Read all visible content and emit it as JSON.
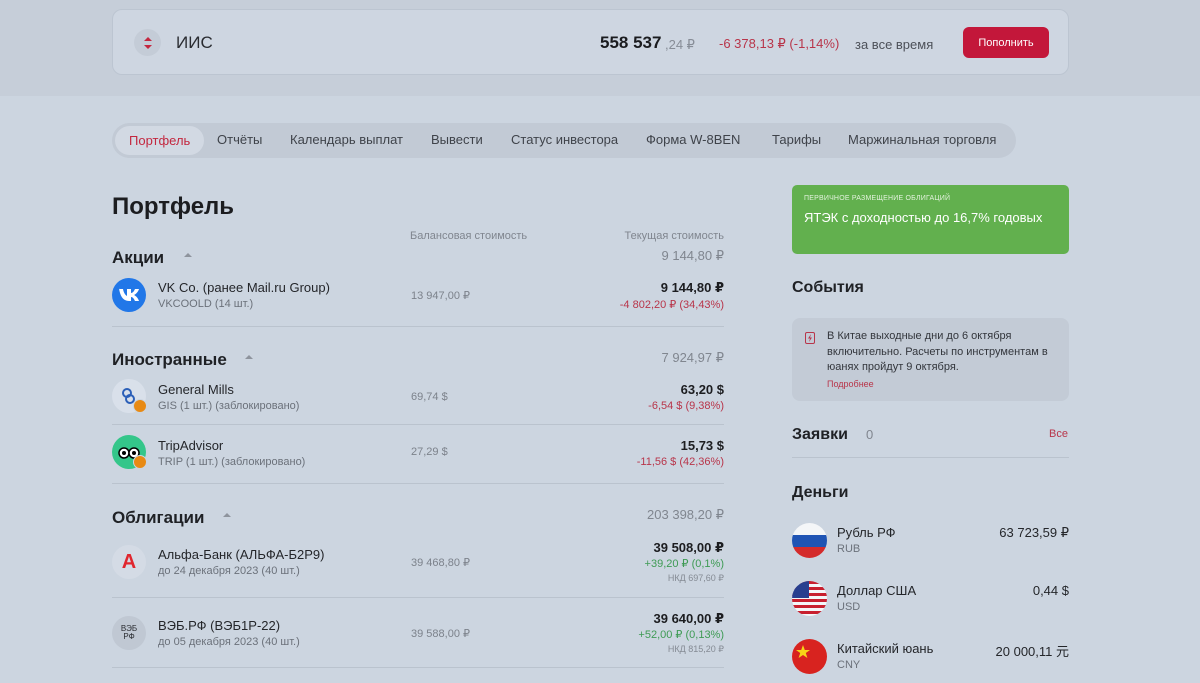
{
  "header": {
    "toggle_icon": "up-down-arrows-icon",
    "account": "ИИС",
    "total_int": "558 537",
    "total_dec": ",24 ₽",
    "change": "-6 378,13 ₽ (-1,14%)",
    "period": "за все время",
    "topup_label": "Пополнить"
  },
  "tabs": [
    "Портфель",
    "Отчёты",
    "Календарь выплат",
    "Вывести",
    "Статус инвестора",
    "Форма W-8BEN",
    "Тарифы",
    "Маржинальная торговля"
  ],
  "portfolio": {
    "title": "Портфель",
    "col_balance": "Балансовая стоимость",
    "col_current": "Текущая стоимость",
    "sections": [
      {
        "name": "Акции",
        "sum": "9 144,80 ₽",
        "rows": [
          {
            "name": "VK Co. (ранее Mail.ru Group)",
            "sub": "VKCOOLD (14 шт.)",
            "balance": "13 947,00 ₽",
            "current": "9 144,80 ₽",
            "change": "-4 802,20 ₽ (34,43%)",
            "icon": "vk-logo-icon"
          }
        ]
      },
      {
        "name": "Иностранные",
        "sum": "7 924,97 ₽",
        "rows": [
          {
            "name": "General Mills",
            "sub": "GIS (1 шт.) (заблокировано)",
            "balance": "69,74 $",
            "current": "63,20 $",
            "change": "-6,54 $ (9,38%)",
            "icon": "general-mills-logo-icon"
          },
          {
            "name": "TripAdvisor",
            "sub": "TRIP (1 шт.) (заблокировано)",
            "balance": "27,29 $",
            "current": "15,73 $",
            "change": "-11,56 $ (42,36%)",
            "icon": "tripadvisor-logo-icon"
          }
        ]
      },
      {
        "name": "Облигации",
        "sum": "203 398,20 ₽",
        "rows": [
          {
            "name": "Альфа-Банк (АЛЬФА-Б2Р9)",
            "sub": "до 24 декабря 2023 (40 шт.)",
            "balance": "39 468,80 ₽",
            "current": "39 508,00 ₽",
            "change": "+39,20 ₽ (0,1%)",
            "nkd": "НКД 697,60 ₽",
            "icon": "alfa-bank-logo-icon",
            "icon_text": "А"
          },
          {
            "name": "ВЭБ.РФ (ВЭБ1Р-22)",
            "sub": "до 05 декабря 2023 (40 шт.)",
            "balance": "39 588,00 ₽",
            "current": "39 640,00 ₽",
            "change": "+52,00 ₽ (0,13%)",
            "nkd": "НКД 815,20 ₽",
            "icon": "veb-logo-icon",
            "icon_text": "ВЭБ\nРФ"
          }
        ]
      }
    ]
  },
  "promo": {
    "tag": "ПЕРВИЧНОЕ РАЗМЕЩЕНИЕ ОБЛИГАЦИЙ",
    "title": "ЯТЭК с доходностью до 16,7% годовых",
    "color": "#62b04e"
  },
  "events": {
    "title": "События",
    "icon": "lightning-icon",
    "text": "В Китае выходные дни до 6 октября включительно. Расчеты по инструментам в юанях пройдут 9 октября.",
    "more": "Подробнее"
  },
  "orders": {
    "title": "Заявки",
    "count": "0",
    "all": "Все"
  },
  "money": {
    "title": "Деньги",
    "items": [
      {
        "name": "Рубль РФ",
        "code": "RUB",
        "amount": "63 723,59 ₽",
        "icon": "russia-flag-icon"
      },
      {
        "name": "Доллар США",
        "code": "USD",
        "amount": "0,44 $",
        "icon": "usa-flag-icon"
      },
      {
        "name": "Китайский юань",
        "code": "CNY",
        "amount": "20 000,11 元",
        "icon": "china-flag-icon"
      }
    ]
  },
  "colors": {
    "accent": "#c3173a",
    "negative": "#b8354a",
    "positive": "#3f9b55"
  }
}
